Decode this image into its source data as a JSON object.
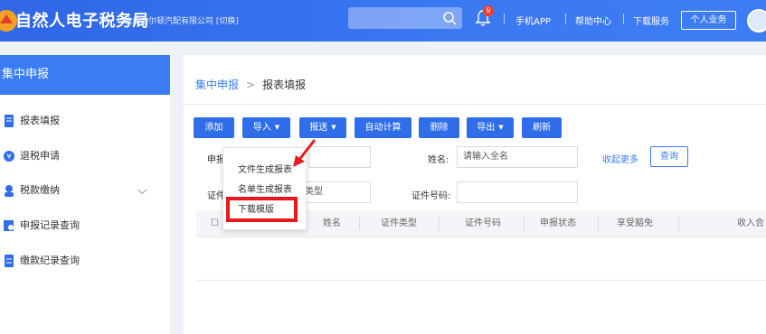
{
  "header": {
    "app_title": "自然人电子税务局",
    "org": "杭州嘉尔顿汽配有限公司 [切换]",
    "bell_count": "9",
    "links": [
      "手机APP",
      "帮助中心",
      "下载服务"
    ],
    "personal_button": "个人业务"
  },
  "sidebar": {
    "title": "集中申报",
    "items": [
      {
        "label": "报表填报",
        "icon": "document-icon"
      },
      {
        "label": "退税申请",
        "icon": "refund-icon"
      },
      {
        "label": "税款缴纳",
        "icon": "tax-payment-icon"
      },
      {
        "label": "申报记录查询",
        "icon": "record-icon"
      },
      {
        "label": "缴款纪录查询",
        "icon": "payment-record-icon"
      }
    ]
  },
  "breadcrumb": {
    "parent": "集中申报",
    "separator": ">",
    "current": "报表填报"
  },
  "toolbar": {
    "add": "添加",
    "import": "导入",
    "submit": "报送",
    "auto_calc": "自动计算",
    "delete": "删除",
    "export": "导出",
    "refresh": "刷新"
  },
  "filters": {
    "declare_label": "申报",
    "name_label": "姓名:",
    "name_placeholder": "请输入全名",
    "collapse": "收起更多",
    "query": "查询",
    "cert_type_label": "证件",
    "cert_type_value": "类型",
    "cert_no_label": "证件号码:"
  },
  "table": {
    "columns": [
      "姓名",
      "证件类型",
      "证件号码",
      "申报状态",
      "享受豁免",
      "收入合"
    ]
  },
  "import_menu": {
    "items": [
      "文件生成报表",
      "名单生成报表",
      "下载模版"
    ]
  },
  "colors": {
    "primary": "#2f6ee8",
    "highlight": "#e8191c"
  }
}
